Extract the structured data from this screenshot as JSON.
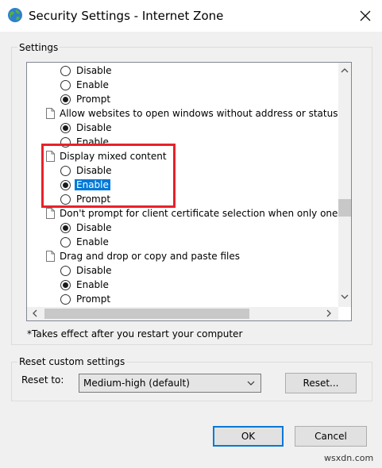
{
  "window": {
    "title": "Security Settings - Internet Zone",
    "close_icon": "close-icon"
  },
  "settings_group": {
    "label": "Settings"
  },
  "settings_list": [
    {
      "kind": "radio",
      "label": "Disable",
      "checked": false
    },
    {
      "kind": "radio",
      "label": "Enable",
      "checked": false
    },
    {
      "kind": "radio",
      "label": "Prompt",
      "checked": true
    },
    {
      "kind": "heading",
      "label": "Allow websites to open windows without address or status b"
    },
    {
      "kind": "radio",
      "label": "Disable",
      "checked": true
    },
    {
      "kind": "radio",
      "label": "Enable",
      "checked": false
    },
    {
      "kind": "heading",
      "label": "Display mixed content"
    },
    {
      "kind": "radio",
      "label": "Disable",
      "checked": false
    },
    {
      "kind": "radio",
      "label": "Enable",
      "checked": true,
      "selected": true
    },
    {
      "kind": "radio",
      "label": "Prompt",
      "checked": false
    },
    {
      "kind": "heading",
      "label": "Don't prompt for client certificate selection when only one ce"
    },
    {
      "kind": "radio",
      "label": "Disable",
      "checked": true
    },
    {
      "kind": "radio",
      "label": "Enable",
      "checked": false
    },
    {
      "kind": "heading",
      "label": "Drag and drop or copy and paste files"
    },
    {
      "kind": "radio",
      "label": "Disable",
      "checked": false
    },
    {
      "kind": "radio",
      "label": "Enable",
      "checked": true
    },
    {
      "kind": "radio",
      "label": "Prompt",
      "checked": false
    }
  ],
  "note": "*Takes effect after you restart your computer",
  "reset_group": {
    "label": "Reset custom settings",
    "reset_to_label": "Reset to:",
    "selected_level": "Medium-high (default)",
    "reset_button": "Reset..."
  },
  "footer": {
    "ok": "OK",
    "cancel": "Cancel"
  },
  "watermark": "wsxdn.com",
  "colors": {
    "selection": "#0078d7",
    "highlight_box": "#e8222a"
  }
}
